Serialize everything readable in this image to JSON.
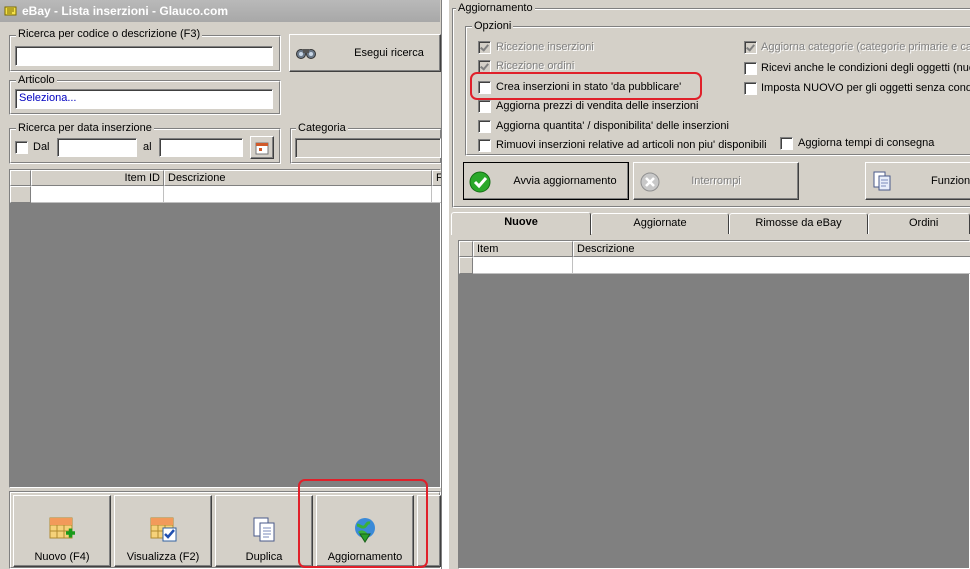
{
  "window": {
    "title": "eBay - Lista inserzioni - Glauco.com"
  },
  "search": {
    "group_label": "Ricerca per codice o descrizione (F3)",
    "value": "",
    "button_label": "Esegui ricerca"
  },
  "article": {
    "group_label": "Articolo",
    "value": "Seleziona..."
  },
  "date_search": {
    "group_label": "Ricerca per data inserzione",
    "from_label": "Dal",
    "to_label": "al",
    "from_value": "",
    "to_value": ""
  },
  "category": {
    "group_label": "Categoria",
    "value": ""
  },
  "left_grid": {
    "columns": [
      "Item ID",
      "Descrizione",
      "F"
    ]
  },
  "bottom_buttons": {
    "new": "Nuovo (F4)",
    "view": "Visualizza (F2)",
    "duplicate": "Duplica",
    "update": "Aggiornamento"
  },
  "update_panel": {
    "group_label": "Aggiornamento",
    "options_label": "Opzioni",
    "options": [
      {
        "label": "Ricezione inserzioni",
        "checked": true,
        "disabled": true
      },
      {
        "label": "Ricezione ordini",
        "checked": true,
        "disabled": true
      },
      {
        "label": "Crea inserzioni in stato 'da pubblicare'",
        "checked": false,
        "disabled": false
      },
      {
        "label": "Aggiorna prezzi di vendita delle inserzioni",
        "checked": false,
        "disabled": false
      },
      {
        "label": "Aggiorna quantita' / disponibilita' delle inserzioni",
        "checked": false,
        "disabled": false
      },
      {
        "label": "Rimuovi inserzioni relative ad articoli non piu' disponibili",
        "checked": false,
        "disabled": false
      }
    ],
    "options_right": [
      {
        "label": "Aggiorna categorie (categorie primarie e cate",
        "checked": true,
        "disabled": true
      },
      {
        "label": "Ricevi anche le condizioni degli oggetti (nuo",
        "checked": false,
        "disabled": false
      },
      {
        "label": "Imposta NUOVO per gli oggetti senza condiz",
        "checked": false,
        "disabled": false
      },
      {
        "label": "Aggiorna tempi di consegna",
        "checked": false,
        "disabled": false
      }
    ],
    "start_button": "Avvia aggiornamento",
    "stop_button": "Interrompi",
    "functions_button": "Funzioni"
  },
  "tabs": [
    "Nuove",
    "Aggiornate",
    "Rimosse da eBay",
    "Ordini"
  ],
  "right_grid": {
    "columns": [
      "Item",
      "Descrizione"
    ]
  },
  "colors": {
    "highlight": "#e0202a",
    "grid_bg": "#808080",
    "face": "#d4d0c8"
  }
}
